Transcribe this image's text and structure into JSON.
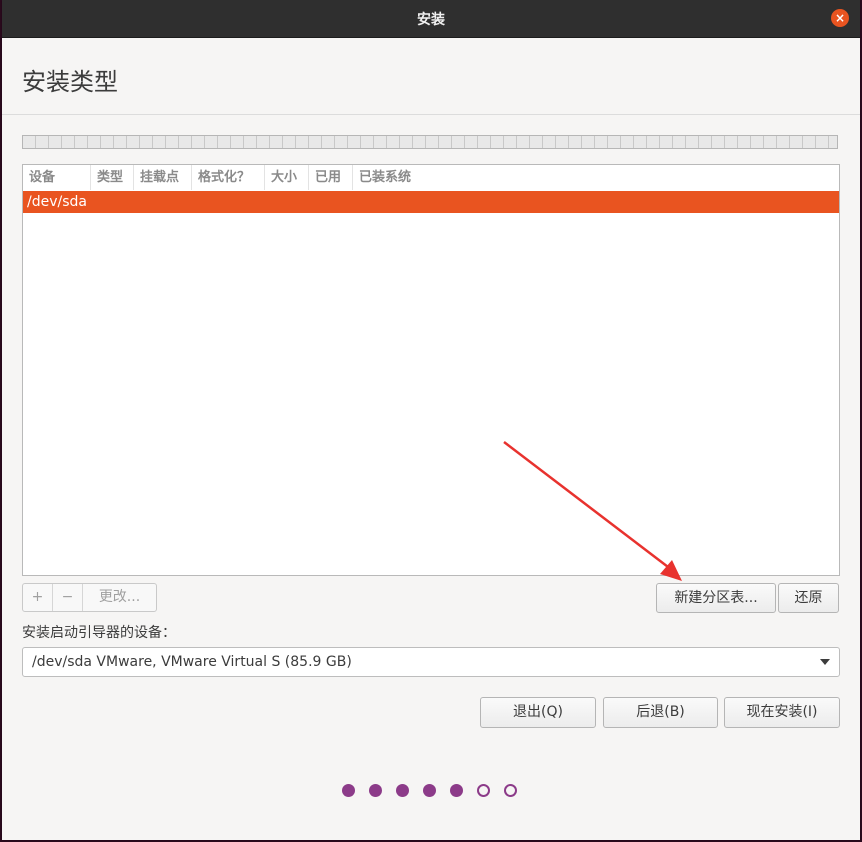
{
  "window": {
    "title": "安装",
    "close_glyph": "×"
  },
  "page": {
    "title": "安装类型"
  },
  "table": {
    "headers": [
      "设备",
      "类型",
      "挂载点",
      "格式化？",
      "大小",
      "已用",
      "已装系统"
    ],
    "rows": [
      {
        "device": "/dev/sda",
        "selected": true
      }
    ]
  },
  "partition_buttons": {
    "add": "+",
    "remove": "−",
    "change": "更改..."
  },
  "new_table_button": "新建分区表...",
  "revert_button": "还原",
  "bootloader": {
    "label": "安装启动引导器的设备：",
    "selected": "/dev/sda VMware, VMware Virtual S (85.9 GB)"
  },
  "nav_buttons": {
    "quit": "退出(Q)",
    "back": "后退(B)",
    "install_now": "现在安装(I)"
  },
  "progress": {
    "total_steps": 7,
    "completed_steps": 5
  },
  "colors": {
    "accent": "#e95420",
    "progress_dot": "#8c3b89",
    "annotation_arrow": "#e8322e"
  }
}
